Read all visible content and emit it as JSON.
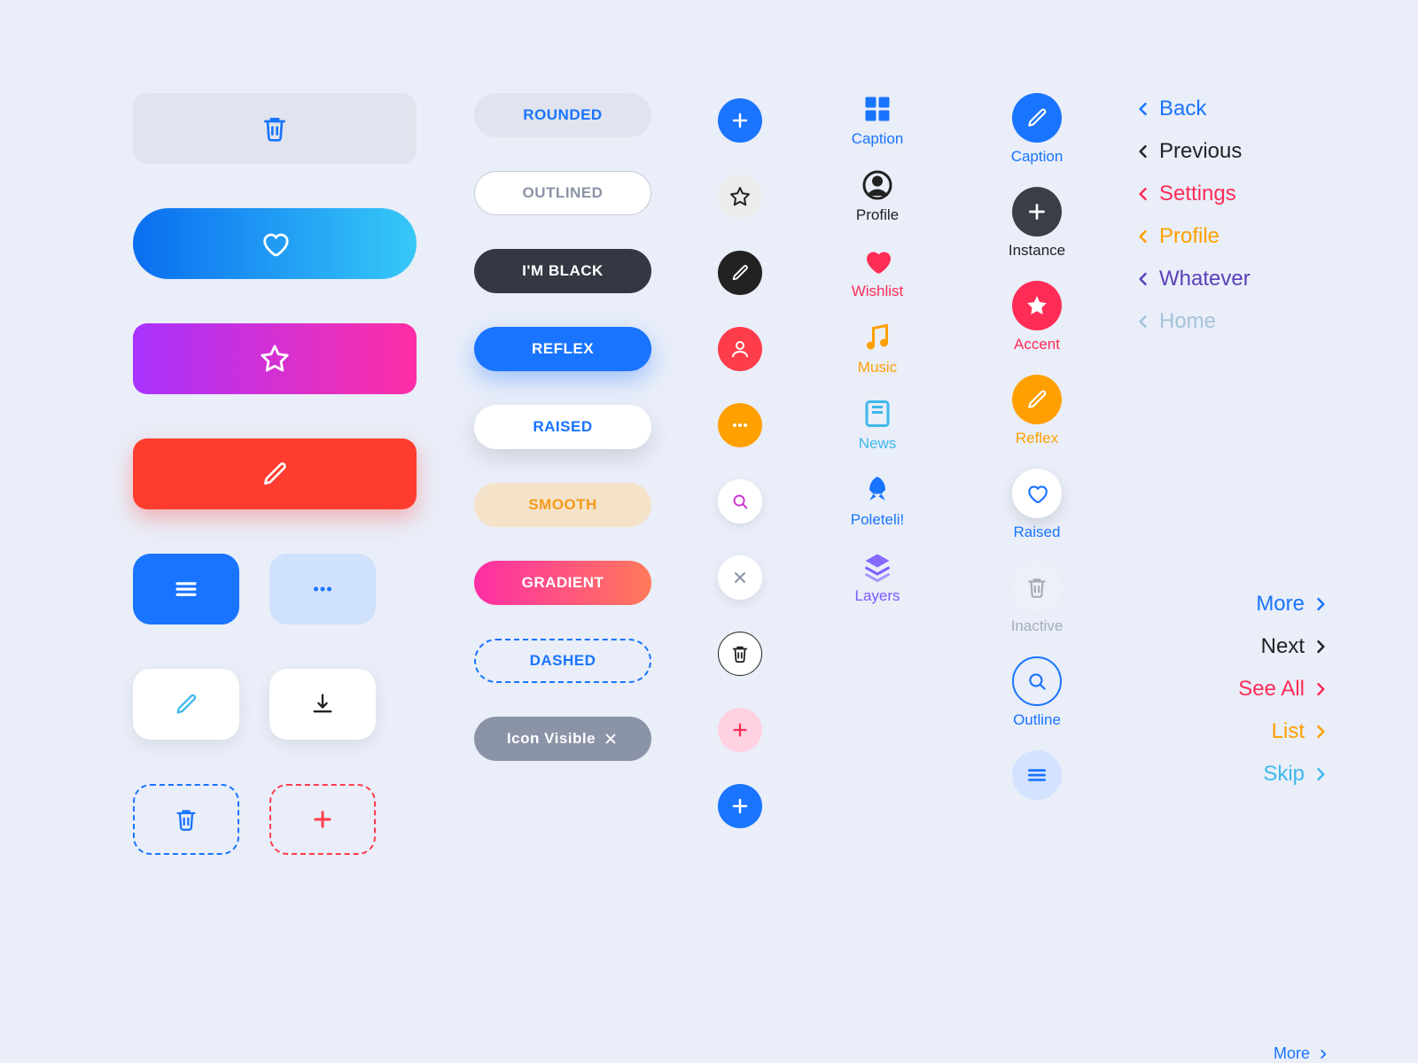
{
  "largeButtons": {
    "trash": "trash",
    "heart": "heart",
    "star": "star",
    "pencil": "pencil"
  },
  "squareButtons": {
    "menu": "menu",
    "dots": "dots",
    "pencil": "pencil",
    "download": "download",
    "trash": "trash",
    "plus": "plus"
  },
  "labelButtons": {
    "rounded": "ROUNDED",
    "outlined": "OUTLINED",
    "black": "I'M BLACK",
    "reflex": "REFLEX",
    "raised": "RAISED",
    "smooth": "SMOOTH",
    "gradient": "GRADIENT",
    "dashed": "DASHED",
    "iconvis": "Icon Visible"
  },
  "circleButtons": {
    "plus": "plus",
    "star": "star",
    "pencil": "pencil",
    "person": "person",
    "dots": "dots",
    "search": "search",
    "close": "close",
    "trash": "trash",
    "plus2": "plus",
    "plus3": "plus"
  },
  "captioned1": [
    {
      "label": "Caption",
      "icon": "grid",
      "color": "blue"
    },
    {
      "label": "Profile",
      "icon": "avatar",
      "color": "black"
    },
    {
      "label": "Wishlist",
      "icon": "heart",
      "color": "red"
    },
    {
      "label": "Music",
      "icon": "music",
      "color": "orange"
    },
    {
      "label": "News",
      "icon": "news",
      "color": "sky"
    },
    {
      "label": "Poleteli!",
      "icon": "rocket",
      "color": "blue"
    },
    {
      "label": "Layers",
      "icon": "layers",
      "color": "purple"
    }
  ],
  "captioned2": [
    {
      "label": "Caption",
      "icon": "pencil",
      "bg": "blue",
      "fg": "white",
      "color": "blue"
    },
    {
      "label": "Instance",
      "icon": "plus",
      "bg": "dark",
      "fg": "white",
      "color": "black"
    },
    {
      "label": "Accent",
      "icon": "star",
      "bg": "red",
      "fg": "white",
      "color": "red"
    },
    {
      "label": "Reflex",
      "icon": "pencil",
      "bg": "orange",
      "fg": "white",
      "color": "orange"
    },
    {
      "label": "Raised",
      "icon": "heart",
      "bg": "white",
      "fg": "blue",
      "color": "blue"
    },
    {
      "label": "Inactive",
      "icon": "trash",
      "bg": "pale",
      "fg": "gray",
      "color": "gray"
    },
    {
      "label": "Outline",
      "icon": "search",
      "bg": "outline",
      "fg": "blue",
      "color": "blue"
    },
    {
      "label": "",
      "icon": "menu",
      "bg": "lightblue",
      "fg": "blue",
      "color": "blue"
    }
  ],
  "navBack": [
    {
      "label": "Back",
      "color": "blue"
    },
    {
      "label": "Previous",
      "color": "black"
    },
    {
      "label": "Settings",
      "color": "red"
    },
    {
      "label": "Profile",
      "color": "orange"
    },
    {
      "label": "Whatever",
      "color": "purple"
    },
    {
      "label": "Home",
      "color": "gray"
    }
  ],
  "navForward": [
    {
      "label": "More",
      "color": "blue"
    },
    {
      "label": "Next",
      "color": "black"
    },
    {
      "label": "See All",
      "color": "red"
    },
    {
      "label": "List",
      "color": "orange"
    },
    {
      "label": "Skip",
      "color": "sky"
    }
  ],
  "navSmall": {
    "label": "More",
    "color": "blue"
  }
}
